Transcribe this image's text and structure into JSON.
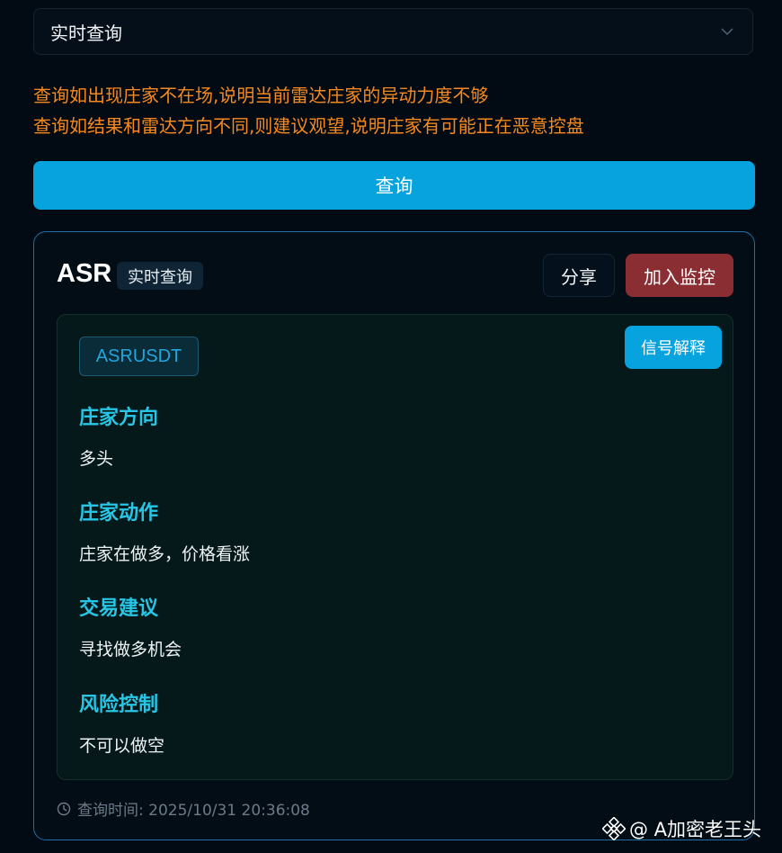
{
  "query_mode": {
    "selected": "实时查询"
  },
  "notices": [
    "查询如出现庄家不在场,说明当前雷达庄家的异动力度不够",
    "查询如结果和雷达方向不同,则建议观望,说明庄家有可能正在恶意控盘"
  ],
  "query_button": "查询",
  "result": {
    "coin": "ASR",
    "mode_tag": "实时查询",
    "share_label": "分享",
    "monitor_label": "加入监控",
    "symbol": "ASRUSDT",
    "explain_label": "信号解释",
    "sections": [
      {
        "title": "庄家方向",
        "text": "多头"
      },
      {
        "title": "庄家动作",
        "text": "庄家在做多，价格看涨"
      },
      {
        "title": "交易建议",
        "text": "寻找做多机会"
      },
      {
        "title": "风险控制",
        "text": "不可以做空"
      }
    ],
    "timestamp": "查询时间: 2025/10/31 20:36:08"
  },
  "watermark": "@ A加密老王头",
  "colors": {
    "accent": "#07a3de",
    "warning_text": "#f5891f",
    "monitor_button": "#8b2e33",
    "section_title": "#27c6e6",
    "card_border": "#1f6fab"
  },
  "icons": [
    "chevron-down-icon",
    "clock-icon",
    "binance-logo-icon"
  ]
}
